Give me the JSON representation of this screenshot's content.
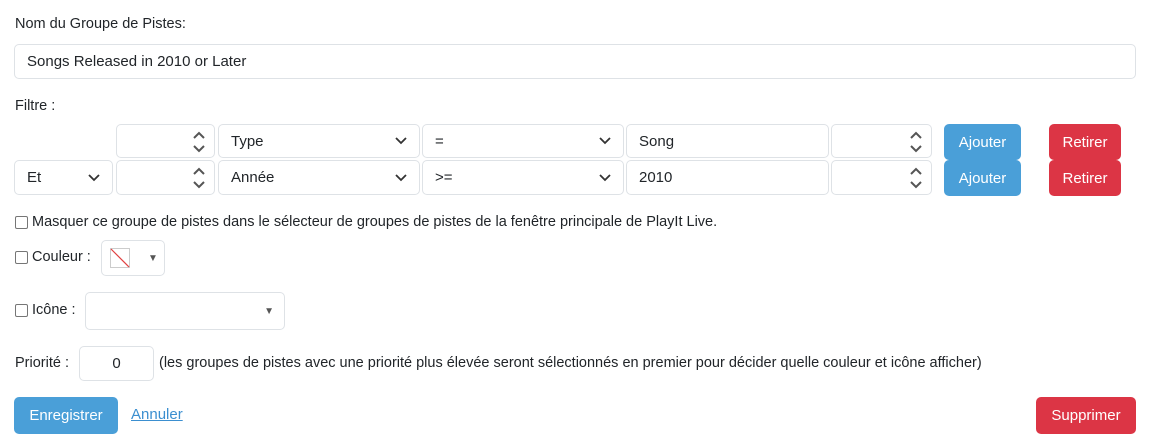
{
  "group_name": {
    "label": "Nom du Groupe de Pistes:",
    "value": "Songs Released in 2010 or Later"
  },
  "filter": {
    "label": "Filtre :",
    "rows": [
      {
        "connector": "",
        "open_paren": "",
        "field": "Type",
        "operator": "=",
        "value": "Song",
        "close_paren": "",
        "add_label": "Ajouter",
        "remove_label": "Retirer"
      },
      {
        "connector": "Et",
        "open_paren": "",
        "field": "Année",
        "operator": ">=",
        "value": "2010",
        "close_paren": "",
        "add_label": "Ajouter",
        "remove_label": "Retirer"
      }
    ]
  },
  "options": {
    "hide_label": "Masquer ce groupe de pistes dans le sélecteur de groupes de pistes de la fenêtre principale de PlayIt Live.",
    "color_label": "Couleur :",
    "icon_label": "Icône :",
    "priority_label": "Priorité :",
    "priority_value": "0",
    "priority_hint": "(les groupes de pistes avec une priorité plus élevée seront sélectionnés en premier pour décider quelle couleur et icône afficher)"
  },
  "actions": {
    "save_label": "Enregistrer",
    "cancel_label": "Annuler",
    "delete_label": "Supprimer"
  },
  "colors": {
    "primary": "#4a9fd8",
    "danger": "#dc3545",
    "border": "#dee2e6",
    "link": "#3b8fd0"
  }
}
